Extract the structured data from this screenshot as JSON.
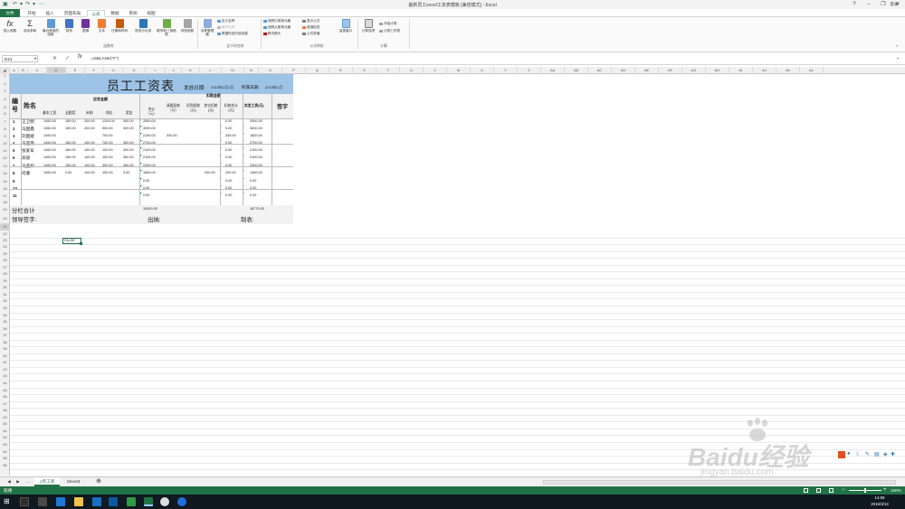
{
  "titlebar": {
    "title": "最新员工excel工资表模板 [兼容模式] - Excel",
    "login": "登录"
  },
  "tabs": [
    "文件",
    "开始",
    "插入",
    "页面布局",
    "公式",
    "数据",
    "审阅",
    "视图"
  ],
  "active_tab": "公式",
  "ribbon": {
    "library": {
      "buttons": [
        "插入函数",
        "自动求和",
        "最近使用的函数",
        "财务",
        "逻辑",
        "文本",
        "日期和时间",
        "查找与引用",
        "数学和三角函数",
        "其他函数"
      ],
      "label": "函数库"
    },
    "names": {
      "manager": "名称管理器",
      "items": [
        "定义名称",
        "用于公式",
        "根据所选内容创建"
      ],
      "label": "定义的名称"
    },
    "audit": {
      "items": [
        "追踪引用单元格",
        "追踪从属单元格",
        "移去箭头",
        "显示公式",
        "错误检查",
        "公式求值"
      ],
      "watch": "监视窗口",
      "label": "公式审核"
    },
    "calc": {
      "options": "计算选项",
      "items": [
        "开始计算",
        "计算工作表"
      ],
      "label": "计算"
    }
  },
  "formula_bar": {
    "name_box": "D21",
    "formula": "=ISBLANK(\"F\")"
  },
  "columns": [
    "A",
    "B",
    "C",
    "D",
    "E",
    "F",
    "G",
    "H",
    "I",
    "J",
    "K",
    "L",
    "M",
    "N",
    "O",
    "P",
    "Q",
    "R",
    "S",
    "T",
    "U",
    "V",
    "W",
    "X",
    "Y",
    "Z",
    "AA",
    "AB",
    "AC",
    "AD",
    "AE",
    "AF",
    "AG",
    "AH",
    "AI",
    "AJ",
    "AK",
    "AL"
  ],
  "rows": [
    "1",
    "2",
    "3",
    "4",
    "5",
    "6",
    "7",
    "8",
    "9",
    "10",
    "11",
    "12",
    "13",
    "14",
    "15",
    "16",
    "17",
    "18",
    "19",
    "20",
    "21",
    "22",
    "23",
    "24",
    "25",
    "26",
    "27",
    "28",
    "29",
    "30",
    "31",
    "32",
    "33",
    "34",
    "35",
    "36",
    "37",
    "38",
    "39",
    "40",
    "41",
    "42",
    "43",
    "44",
    "45",
    "46",
    "47",
    "48",
    "49",
    "50",
    "51",
    "52",
    "53",
    "54",
    "55",
    "56",
    "57",
    "58",
    "59"
  ],
  "payroll": {
    "title": "员工工资表",
    "date_label": "发放日期:",
    "date_value": "2015年2月1日",
    "period_label": "所属日期:",
    "period_value": "2015年1月",
    "col_no": "编号",
    "col_name": "姓名",
    "group_pay": "应发金额",
    "group_deduct": "扣款金额",
    "col_base": "基本工资",
    "col_allow": "全勤奖",
    "col_sub": "补助",
    "col_post": "岗位",
    "col_bonus": "奖金",
    "col_total": "合计（元）",
    "col_leave": "请假扣款（元）",
    "col_late": "迟到扣款(元)",
    "col_other": "其它扣款(元)",
    "col_deduct_total": "扣款合计(元)",
    "col_net": "实发工资(元)",
    "col_sign": "签字",
    "records": [
      {
        "no": "1",
        "name": "王卫明",
        "base": "1450.00",
        "allow": "150.00",
        "sub": "200.00",
        "post": "1200.00",
        "bonus": "300.00",
        "total": "3300.00",
        "leave": "",
        "late": "",
        "other": "",
        "dtotal": "0.00",
        "net": "3300.00"
      },
      {
        "no": "2",
        "name": "马国鑫",
        "base": "1450.00",
        "allow": "150.00",
        "sub": "200.00",
        "post": "900.00",
        "bonus": "300.00",
        "total": "3000.00",
        "leave": "",
        "late": "",
        "other": "",
        "dtotal": "0.00",
        "net": "3000.00"
      },
      {
        "no": "3",
        "name": "刘国斌",
        "base": "1450.00",
        "allow": "",
        "sub": "",
        "post": "700.00",
        "bonus": "",
        "total": "2150.00",
        "leave": "330.00",
        "late": "",
        "other": "",
        "dtotal": "330.00",
        "net": "1820.00"
      },
      {
        "no": "4",
        "name": "马亚南",
        "base": "1450.00",
        "allow": "150.00",
        "sub": "100.00",
        "post": "700.00",
        "bonus": "300.00",
        "total": "2700.00",
        "leave": "",
        "late": "",
        "other": "",
        "dtotal": "0.00",
        "net": "2700.00"
      },
      {
        "no": "5",
        "name": "张爱军",
        "base": "1450.00",
        "allow": "150.00",
        "sub": "100.00",
        "post": "100.00",
        "bonus": "300.00",
        "total": "2100.00",
        "leave": "",
        "late": "",
        "other": "",
        "dtotal": "0.00",
        "net": "2100.00"
      },
      {
        "no": "6",
        "name": "高丽",
        "base": "1450.00",
        "allow": "150.00",
        "sub": "100.00",
        "post": "100.00",
        "bonus": "300.00",
        "total": "2100.00",
        "leave": "",
        "late": "",
        "other": "",
        "dtotal": "0.00",
        "net": "2100.00"
      },
      {
        "no": "7",
        "name": "马亚如",
        "base": "1450.00",
        "allow": "150.00",
        "sub": "100.00",
        "post": "300.00",
        "bonus": "300.00",
        "total": "2300.00",
        "leave": "",
        "late": "",
        "other": "",
        "dtotal": "0.00",
        "net": "2300.00"
      },
      {
        "no": "8",
        "name": "司睿",
        "base": "1450.00",
        "allow": "0.00",
        "sub": "100.00",
        "post": "100.00",
        "bonus": "0.00",
        "total": "1650.00",
        "leave": "",
        "late": "",
        "other": "200.00",
        "dtotal": "200.00",
        "net": "1450.00"
      },
      {
        "no": "9",
        "name": "",
        "base": "",
        "allow": "",
        "sub": "",
        "post": "",
        "bonus": "",
        "total": "0.00",
        "leave": "",
        "late": "",
        "other": "",
        "dtotal": "0.00",
        "net": "0.00"
      },
      {
        "no": "10",
        "name": "",
        "base": "",
        "allow": "",
        "sub": "",
        "post": "",
        "bonus": "",
        "total": "0.00",
        "leave": "",
        "late": "",
        "other": "",
        "dtotal": "0.00",
        "net": "0.00"
      },
      {
        "no": "11",
        "name": "",
        "base": "",
        "allow": "",
        "sub": "",
        "post": "",
        "bonus": "",
        "total": "0.00",
        "leave": "",
        "late": "",
        "other": "",
        "dtotal": "0.00",
        "net": "0.00"
      }
    ],
    "subtotal_label": "分栏合计",
    "subtotal_total": "19300.00",
    "subtotal_net": "18770.00",
    "leader_label": "领导签字:",
    "cashier_label": "出纳:",
    "maker_label": "制表:"
  },
  "selected_cell_value": "FALSE",
  "sheets": [
    "1月工资",
    "Sheet3"
  ],
  "active_sheet": "1月工资",
  "status": {
    "ready": "就绪",
    "zoom": "100%"
  },
  "taskbar": {
    "time": "14:59",
    "date": "2016/3/13"
  },
  "watermark": {
    "brand": "Baidu经验",
    "url": "jingyan.baidu.com"
  }
}
